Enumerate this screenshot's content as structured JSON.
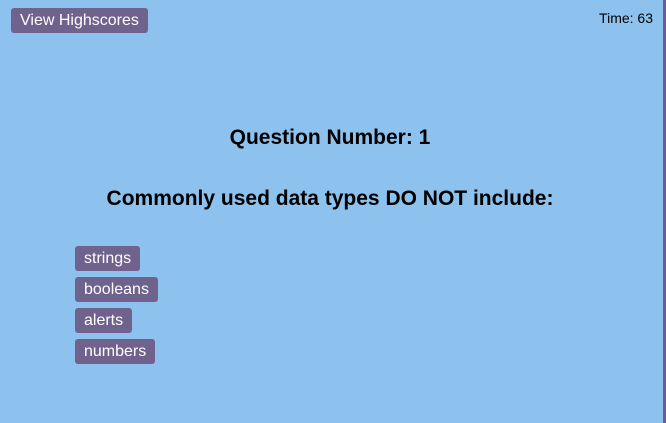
{
  "header": {
    "highscores_label": "View Highscores",
    "timer_label": "Time:",
    "timer_value": "63"
  },
  "quiz": {
    "question_number_label": "Question Number:",
    "question_number": "1",
    "question_text": "Commonly used data types DO NOT include:",
    "choices": [
      "strings",
      "booleans",
      "alerts",
      "numbers"
    ]
  },
  "colors": {
    "background": "#8dc1ee",
    "button": "#6f628d",
    "button_text": "#ffffff",
    "edge_accent": "#6f5a95"
  }
}
